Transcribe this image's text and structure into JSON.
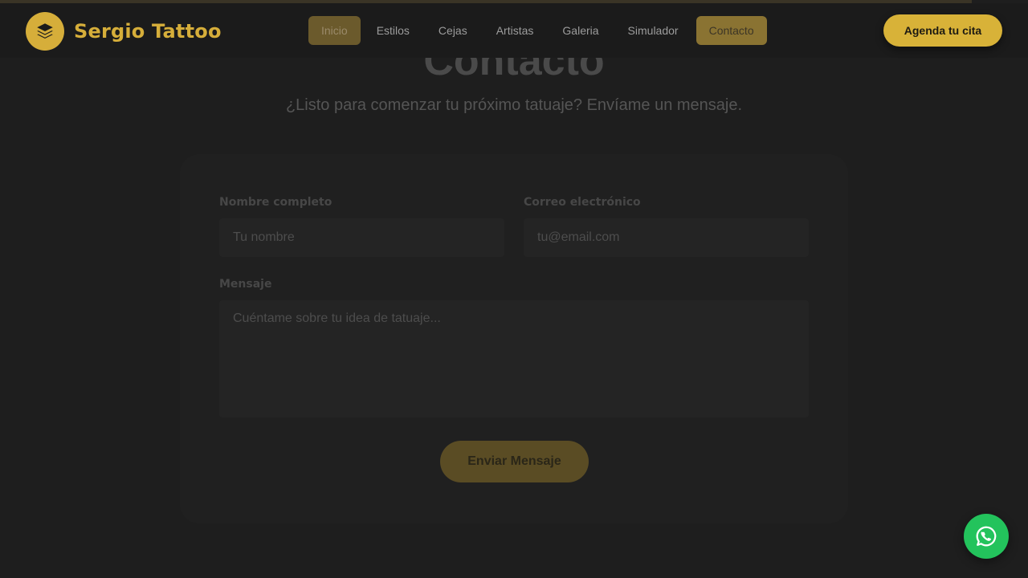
{
  "header": {
    "brand_name": "Sergio Tattoo",
    "logo_icon": "layers-icon",
    "nav": [
      {
        "label": "Inicio"
      },
      {
        "label": "Estilos"
      },
      {
        "label": "Cejas"
      },
      {
        "label": "Artistas"
      },
      {
        "label": "Galeria"
      },
      {
        "label": "Simulador"
      },
      {
        "label": "Contacto"
      }
    ],
    "cta_label": "Agenda tu cita"
  },
  "contact": {
    "title": "Contacto",
    "subtitle": "¿Listo para comenzar tu próximo tatuaje? Envíame un mensaje.",
    "name_label": "Nombre completo",
    "name_placeholder": "Tu nombre",
    "email_label": "Correo electrónico",
    "email_placeholder": "tu@email.com",
    "message_label": "Mensaje",
    "message_placeholder": "Cuéntame sobre tu idea de tatuaje...",
    "submit_label": "Enviar Mensaje"
  },
  "floating": {
    "whatsapp_icon": "whatsapp-icon"
  },
  "colors": {
    "accent": "#d6ae3a",
    "background": "#1e1e1e",
    "whatsapp": "#23c35c"
  }
}
